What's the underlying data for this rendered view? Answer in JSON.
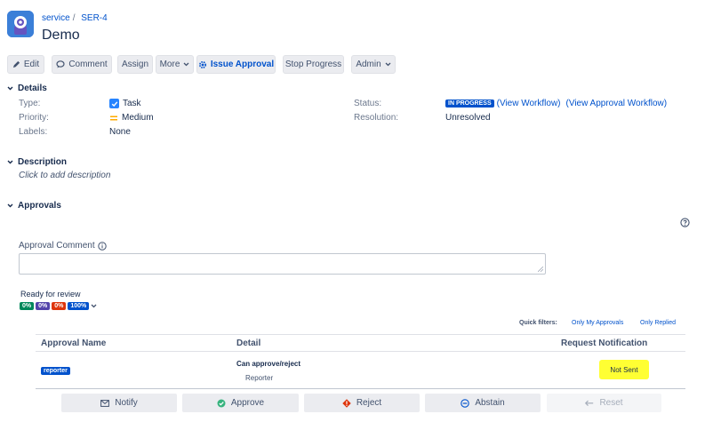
{
  "header": {
    "project": "service",
    "issue_key": "SER-4",
    "title": "Demo"
  },
  "toolbar": {
    "edit": "Edit",
    "comment": "Comment",
    "assign": "Assign",
    "more": "More",
    "issue_approval": "Issue Approval",
    "stop_progress": "Stop Progress",
    "admin": "Admin"
  },
  "details": {
    "heading": "Details",
    "type_label": "Type:",
    "type_value": "Task",
    "priority_label": "Priority:",
    "priority_value": "Medium",
    "labels_label": "Labels:",
    "labels_value": "None",
    "status_label": "Status:",
    "status_value": "IN PROGRESS",
    "view_workflow": "(View Workflow)",
    "view_approval_workflow": "(View Approval Workflow)",
    "resolution_label": "Resolution:",
    "resolution_value": "Unresolved"
  },
  "description": {
    "heading": "Description",
    "placeholder": "Click to add description"
  },
  "approvals": {
    "heading": "Approvals",
    "comment_label": "Approval Comment",
    "ready_label": "Ready for review",
    "progress": [
      {
        "label": "0%",
        "color": "#00875a"
      },
      {
        "label": "0%",
        "color": "#5243aa"
      },
      {
        "label": "0%",
        "color": "#de350b"
      },
      {
        "label": "100%",
        "color": "#0052cc"
      }
    ],
    "quick_filters_label": "Quick filters:",
    "only_my_approvals": "Only My Approvals",
    "only_replied": "Only Replied",
    "columns": {
      "name": "Approval Name",
      "detail": "Detail",
      "notification": "Request Notification"
    },
    "row": {
      "name": "reporter",
      "detail_title": "Can approve/reject",
      "detail_sub": "Reporter",
      "notification": "Not Sent"
    },
    "actions": {
      "notify": "Notify",
      "approve": "Approve",
      "reject": "Reject",
      "abstain": "Abstain",
      "reset": "Reset"
    }
  },
  "colors": {
    "link": "#0052cc",
    "highlight": "#ffff33",
    "approve": "#36b37e",
    "reject": "#de350b"
  }
}
